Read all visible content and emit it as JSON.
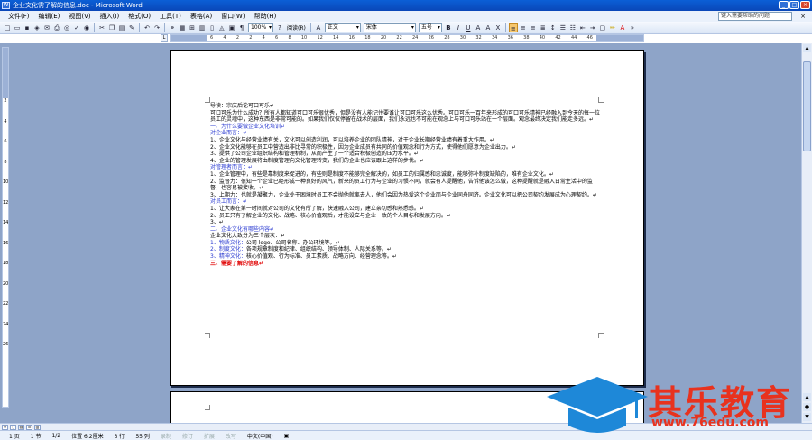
{
  "window": {
    "title": "企业文化需了解的信息.doc - Microsoft Word"
  },
  "menu": {
    "items": [
      "文件(F)",
      "编辑(E)",
      "视图(V)",
      "插入(I)",
      "格式(O)",
      "工具(T)",
      "表格(A)",
      "窗口(W)",
      "帮助(H)"
    ]
  },
  "help": {
    "placeholder": "键入需要帮助的问题"
  },
  "toolbar": {
    "zoom": "100%",
    "read_label": "阅读(R)",
    "style": "正文",
    "font": "宋体",
    "size": "五号",
    "bold": "B",
    "italic": "I",
    "underline": "U",
    "font_color": "A"
  },
  "ruler": {
    "numbers": [
      "6",
      "4",
      "2",
      "2",
      "4",
      "6",
      "8",
      "10",
      "12",
      "14",
      "16",
      "18",
      "20",
      "22",
      "24",
      "26",
      "28",
      "30",
      "32",
      "34",
      "36",
      "38",
      "40",
      "42",
      "44",
      "46"
    ],
    "vnumbers": [
      "2",
      "4",
      "6",
      "8",
      "10",
      "12",
      "14",
      "16",
      "18",
      "20",
      "22",
      "24",
      "26"
    ]
  },
  "document": {
    "paragraphs": [
      {
        "text": "导读：宗庆后论可口可乐↵",
        "style": ""
      },
      {
        "text": "可口可乐为什么成功？所有人都知道可口可乐很优秀，但是没有人能记住要谁让可口可乐这么优秀。可口可乐一百年来形成的可口可乐精神已经融入到今天的每一位员工的灵魂中，这种东西是非常可能的。如果我们仅仅停留在战术的层面，我们永远也不可能在观念上与可口可乐站在一个层面。观念最终决定我们能走多远。↵",
        "style": ""
      },
      {
        "text": "一、为什么要做企业文化培训↵",
        "style": "blue"
      },
      {
        "text": "对企业而言：↵",
        "style": "blue"
      },
      {
        "text": "1、企业文化与经营业绩有关，文化可以创造利润，可以培养企业的团队精神，对于企业长期经营业绩有着重大作用。↵",
        "style": ""
      },
      {
        "text": "2、企业文化能够在员工中营造出非比寻常的积极性，因为企业成员有共同的价值观念和行为方式，使得他们愿意为企业出力。↵",
        "style": ""
      },
      {
        "text": "3、提供了公司企业组织结构和管理机制，从而产生了一个适合积极创造的压力水平。↵",
        "style": ""
      },
      {
        "text": "4、企业的管理发展将由制度管理向文化管理转变，我们的企业也应该跟上这样的步伐。↵",
        "style": ""
      },
      {
        "text": "对管理者而言：↵",
        "style": "blue"
      },
      {
        "text": "1、企业管理中，有些是靠制度来促进的，有些则是制度不能够完全解决的，如员工的归属感和忠诚度，能够弥补制度缺陷的，唯有企业文化。↵",
        "style": ""
      },
      {
        "text": "2、监督力：很知一个企业已经形成一种良好的风气，新来的员工行为与企业的习惯不同，就会有人提醒他，告诉他该怎么做，这种提醒就是融入日常生活中的监督，也容易被接收。↵",
        "style": ""
      },
      {
        "text": "3、上期力：也就是凝聚力，企业处于困境时员工不会抛他就离去人，他们会因为热爱这个企业而与企业同舟同济。企业文化可以把公司契约发展成为心理契约。↵",
        "style": ""
      },
      {
        "text": "对员工而言：↵",
        "style": "blue"
      },
      {
        "text": "1、让大家在第一时间就对公司的文化有所了解，快速融入公司，建立亲切感和熟悉感。↵",
        "style": ""
      },
      {
        "text": "2、员工只有了解企业的文化、战略、核心价值观后，才能设立与企业一致的个人目标和发展方向。↵",
        "style": ""
      },
      {
        "text": "3、↵",
        "style": ""
      },
      {
        "text": "二、企业文化有哪些内容↵",
        "style": "blue"
      },
      {
        "text": "企业文化大致分为三个层次：↵",
        "style": ""
      },
      {
        "text": "1、物质文化：公司 logo、公司名称、办公环境等。↵",
        "style": "mixed1"
      },
      {
        "text": "2、制度文化：各项规章制度和纪律、组织结构、领导体制、人际关系等。↵",
        "style": "mixed2"
      },
      {
        "text": "3、精神文化：核心价值观、行为标准、员工素质、战略方向、经营理念等。↵",
        "style": "mixed3"
      },
      {
        "text": "三、需要了解的信息↵",
        "style": "red"
      }
    ]
  },
  "status": {
    "page": "1 页",
    "section": "1 节",
    "count": "1/2",
    "position": "位置 6.2厘米",
    "line": "3 行",
    "column": "55 列",
    "rec": "录制",
    "trk": "修订",
    "ext": "扩展",
    "ovr": "改写",
    "lang": "中文(中国)"
  },
  "watermark": {
    "text": "其乐教育",
    "url": "www.76edu.com"
  }
}
